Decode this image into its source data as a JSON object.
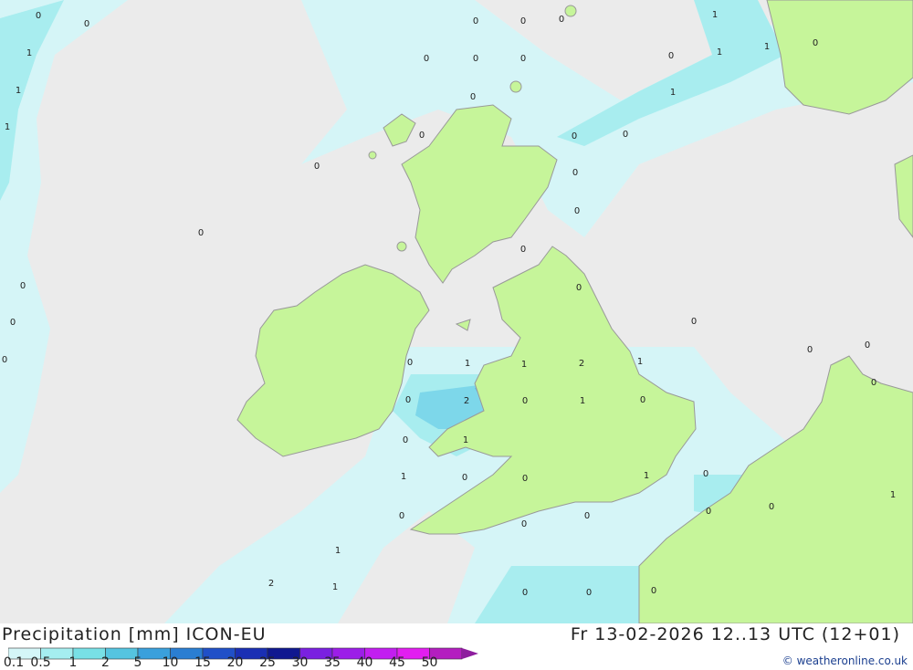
{
  "header": {
    "legend_title": "Precipitation [mm] ICON-EU",
    "timestamp": "Fr 13-02-2026 12..13 UTC (12+01)",
    "credit": "© weatheronline.co.uk"
  },
  "colors": {
    "sea": "#ebebeb",
    "land": "#c6f59a",
    "border": "#999999",
    "precip_light": "#d4f6f8",
    "precip_medium": "#a5eef0",
    "precip_heavy": "#78d6ea",
    "precip_strong": "#5fb4e6"
  },
  "legend": {
    "labels": [
      "0.1",
      "0.5",
      "1",
      "2",
      "5",
      "10",
      "15",
      "20",
      "25",
      "30",
      "35",
      "40",
      "45",
      "50"
    ],
    "swatches": [
      "#d4f6f8",
      "#a5eef0",
      "#78e0e6",
      "#55c4e0",
      "#3aa0dc",
      "#2a7ed2",
      "#2050c8",
      "#1a2fb4",
      "#101890",
      "#7a20e0",
      "#9c1ee8",
      "#c21ef0",
      "#e21ef0",
      "#b41ec0"
    ],
    "arrow_color": "#8e1e9e"
  },
  "precip_labels": [
    "0",
    "0",
    "1",
    "1",
    "1",
    "0",
    "0",
    "0",
    "0",
    "0",
    "0",
    "0",
    "0",
    "0",
    "0",
    "0",
    "0",
    "1",
    "1",
    "1",
    "0",
    "0",
    "0",
    "1",
    "0",
    "0",
    "0",
    "0",
    "0",
    "0",
    "0",
    "0",
    "0",
    "1",
    "0",
    "0",
    "0",
    "1",
    "2",
    "2",
    "0",
    "1",
    "1",
    "0",
    "1",
    "0",
    "0",
    "1",
    "0",
    "0",
    "1",
    "0",
    "0",
    "0",
    "0",
    "0",
    "1",
    "1",
    "2",
    "1",
    "0",
    "0",
    "0"
  ]
}
